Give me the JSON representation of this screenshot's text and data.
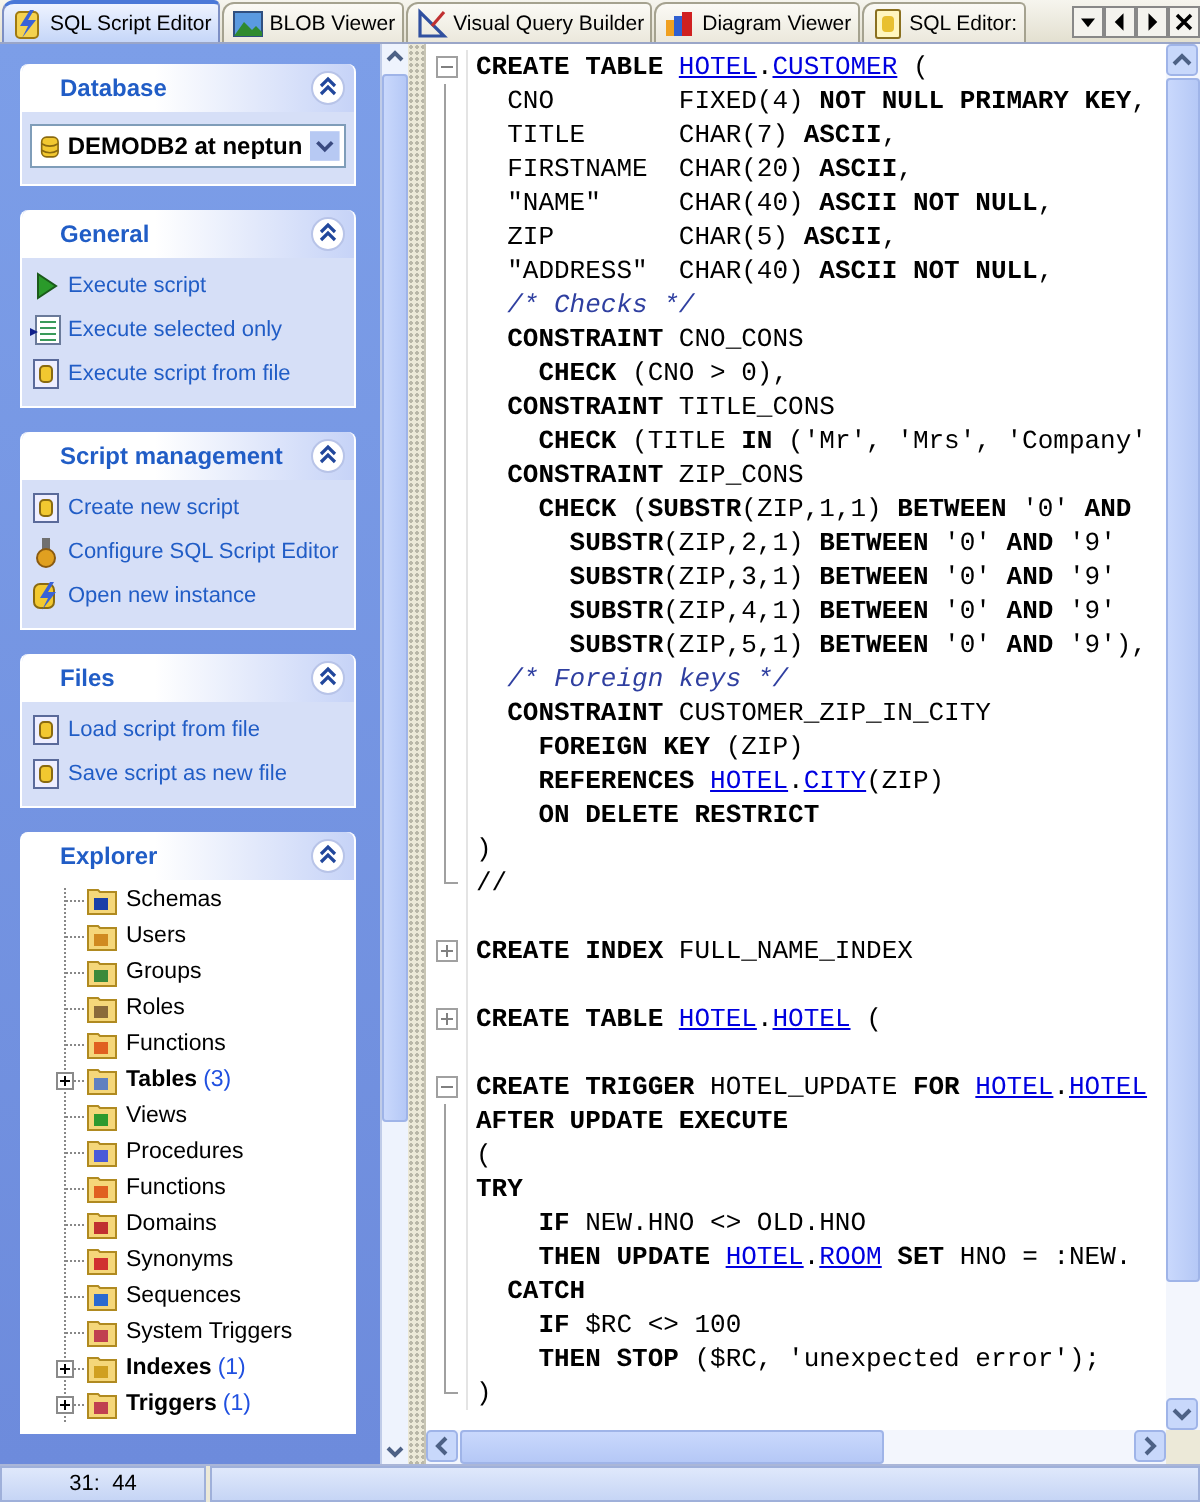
{
  "tabs": [
    {
      "label": "SQL Script Editor",
      "selected": true
    },
    {
      "label": "BLOB Viewer",
      "selected": false
    },
    {
      "label": "Visual Query Builder",
      "selected": false
    },
    {
      "label": "Diagram Viewer",
      "selected": false
    },
    {
      "label": "SQL Editor:",
      "selected": false
    }
  ],
  "sidebar": {
    "groups": [
      {
        "title": "Database",
        "expanded": true,
        "database": "DEMODB2 at neptun"
      },
      {
        "title": "General",
        "expanded": true,
        "items": [
          "Execute script",
          "Execute selected only",
          "Execute script from file"
        ]
      },
      {
        "title": "Script management",
        "expanded": true,
        "items": [
          "Create new script",
          "Configure SQL Script Editor",
          "Open new instance"
        ]
      },
      {
        "title": "Files",
        "expanded": true,
        "items": [
          "Load script from file",
          "Save script as new file"
        ]
      }
    ],
    "explorer": {
      "title": "Explorer",
      "expanded": true,
      "items": [
        {
          "label": "Schemas"
        },
        {
          "label": "Users"
        },
        {
          "label": "Groups"
        },
        {
          "label": "Roles"
        },
        {
          "label": "Functions"
        },
        {
          "label": "Tables",
          "count": "(3)",
          "expanded": false
        },
        {
          "label": "Views"
        },
        {
          "label": "Procedures"
        },
        {
          "label": "Functions"
        },
        {
          "label": "Domains"
        },
        {
          "label": "Synonyms"
        },
        {
          "label": "Sequences"
        },
        {
          "label": "System Triggers"
        },
        {
          "label": "Indexes",
          "count": "(1)",
          "expanded": false
        },
        {
          "label": "Triggers",
          "count": "(1)",
          "expanded": false
        }
      ]
    }
  },
  "editor": {
    "lines": [
      {
        "folded": false,
        "segments": [
          {
            "kind": "kw",
            "text": "CREATE TABLE "
          },
          {
            "kind": "link",
            "text": "HOTEL"
          },
          {
            "kind": "id",
            "text": "."
          },
          {
            "kind": "link",
            "text": "CUSTOMER"
          },
          {
            "kind": "id",
            "text": " ("
          }
        ]
      },
      {
        "segments": [
          {
            "kind": "id",
            "text": "  CNO        FIXED(4) "
          },
          {
            "kind": "kw",
            "text": "NOT NULL PRIMARY KEY"
          },
          {
            "kind": "id",
            "text": ","
          }
        ]
      },
      {
        "segments": [
          {
            "kind": "id",
            "text": "  TITLE      CHAR(7) "
          },
          {
            "kind": "kw",
            "text": "ASCII"
          },
          {
            "kind": "id",
            "text": ","
          }
        ]
      },
      {
        "segments": [
          {
            "kind": "id",
            "text": "  FIRSTNAME  CHAR(20) "
          },
          {
            "kind": "kw",
            "text": "ASCII"
          },
          {
            "kind": "id",
            "text": ","
          }
        ]
      },
      {
        "segments": [
          {
            "kind": "id",
            "text": "  \"NAME\"     CHAR(40) "
          },
          {
            "kind": "kw",
            "text": "ASCII NOT NULL"
          },
          {
            "kind": "id",
            "text": ","
          }
        ]
      },
      {
        "segments": [
          {
            "kind": "id",
            "text": "  ZIP        CHAR(5) "
          },
          {
            "kind": "kw",
            "text": "ASCII"
          },
          {
            "kind": "id",
            "text": ","
          }
        ]
      },
      {
        "segments": [
          {
            "kind": "id",
            "text": "  \"ADDRESS\"  CHAR(40) "
          },
          {
            "kind": "kw",
            "text": "ASCII NOT NULL"
          },
          {
            "kind": "id",
            "text": ","
          }
        ]
      },
      {
        "segments": [
          {
            "kind": "cm",
            "text": "  /* Checks */"
          }
        ]
      },
      {
        "segments": [
          {
            "kind": "kw",
            "text": "  CONSTRAINT "
          },
          {
            "kind": "id",
            "text": "CNO_CONS"
          }
        ]
      },
      {
        "segments": [
          {
            "kind": "kw",
            "text": "    CHECK "
          },
          {
            "kind": "id",
            "text": "(CNO > 0),"
          }
        ]
      },
      {
        "segments": [
          {
            "kind": "kw",
            "text": "  CONSTRAINT "
          },
          {
            "kind": "id",
            "text": "TITLE_CONS"
          }
        ]
      },
      {
        "segments": [
          {
            "kind": "kw",
            "text": "    CHECK "
          },
          {
            "kind": "id",
            "text": "(TITLE "
          },
          {
            "kind": "kw",
            "text": "IN"
          },
          {
            "kind": "id",
            "text": " ('Mr', 'Mrs', 'Company'"
          }
        ]
      },
      {
        "segments": [
          {
            "kind": "kw",
            "text": "  CONSTRAINT "
          },
          {
            "kind": "id",
            "text": "ZIP_CONS"
          }
        ]
      },
      {
        "segments": [
          {
            "kind": "kw",
            "text": "    CHECK "
          },
          {
            "kind": "id",
            "text": "("
          },
          {
            "kind": "kw",
            "text": "SUBSTR"
          },
          {
            "kind": "id",
            "text": "(ZIP,1,1) "
          },
          {
            "kind": "kw",
            "text": "BETWEEN"
          },
          {
            "kind": "id",
            "text": " '0' "
          },
          {
            "kind": "kw",
            "text": "AND"
          }
        ]
      },
      {
        "segments": [
          {
            "kind": "kw",
            "text": "      SUBSTR"
          },
          {
            "kind": "id",
            "text": "(ZIP,2,1) "
          },
          {
            "kind": "kw",
            "text": "BETWEEN"
          },
          {
            "kind": "id",
            "text": " '0' "
          },
          {
            "kind": "kw",
            "text": "AND"
          },
          {
            "kind": "id",
            "text": " '9'"
          }
        ]
      },
      {
        "segments": [
          {
            "kind": "kw",
            "text": "      SUBSTR"
          },
          {
            "kind": "id",
            "text": "(ZIP,3,1) "
          },
          {
            "kind": "kw",
            "text": "BETWEEN"
          },
          {
            "kind": "id",
            "text": " '0' "
          },
          {
            "kind": "kw",
            "text": "AND"
          },
          {
            "kind": "id",
            "text": " '9'"
          }
        ]
      },
      {
        "segments": [
          {
            "kind": "kw",
            "text": "      SUBSTR"
          },
          {
            "kind": "id",
            "text": "(ZIP,4,1) "
          },
          {
            "kind": "kw",
            "text": "BETWEEN"
          },
          {
            "kind": "id",
            "text": " '0' "
          },
          {
            "kind": "kw",
            "text": "AND"
          },
          {
            "kind": "id",
            "text": " '9'"
          }
        ]
      },
      {
        "segments": [
          {
            "kind": "kw",
            "text": "      SUBSTR"
          },
          {
            "kind": "id",
            "text": "(ZIP,5,1) "
          },
          {
            "kind": "kw",
            "text": "BETWEEN"
          },
          {
            "kind": "id",
            "text": " '0' "
          },
          {
            "kind": "kw",
            "text": "AND"
          },
          {
            "kind": "id",
            "text": " '9'),"
          }
        ]
      },
      {
        "segments": [
          {
            "kind": "cm",
            "text": "  /* Foreign keys */"
          }
        ]
      },
      {
        "segments": [
          {
            "kind": "kw",
            "text": "  CONSTRAINT "
          },
          {
            "kind": "id",
            "text": "CUSTOMER_ZIP_IN_CITY"
          }
        ]
      },
      {
        "segments": [
          {
            "kind": "kw",
            "text": "    FOREIGN KEY "
          },
          {
            "kind": "id",
            "text": "(ZIP)"
          }
        ]
      },
      {
        "segments": [
          {
            "kind": "kw",
            "text": "    REFERENCES "
          },
          {
            "kind": "link",
            "text": "HOTEL"
          },
          {
            "kind": "id",
            "text": "."
          },
          {
            "kind": "link",
            "text": "CITY"
          },
          {
            "kind": "id",
            "text": "(ZIP)"
          }
        ]
      },
      {
        "segments": [
          {
            "kind": "kw",
            "text": "    ON DELETE RESTRICT"
          }
        ]
      },
      {
        "segments": [
          {
            "kind": "id",
            "text": ")"
          }
        ]
      },
      {
        "segments": [
          {
            "kind": "id",
            "text": "//"
          }
        ]
      },
      {
        "gap_before": true,
        "folded": true,
        "segments": [
          {
            "kind": "kw",
            "text": "CREATE INDEX "
          },
          {
            "kind": "id",
            "text": "FULL_NAME_INDEX"
          }
        ]
      },
      {
        "gap_before": true,
        "folded": true,
        "segments": [
          {
            "kind": "kw",
            "text": "CREATE TABLE "
          },
          {
            "kind": "link",
            "text": "HOTEL"
          },
          {
            "kind": "id",
            "text": "."
          },
          {
            "kind": "link",
            "text": "HOTEL"
          },
          {
            "kind": "id",
            "text": " ("
          }
        ]
      },
      {
        "gap_before": true,
        "folded": false,
        "segments": [
          {
            "kind": "kw",
            "text": "CREATE TRIGGER "
          },
          {
            "kind": "id",
            "text": "HOTEL_UPDATE "
          },
          {
            "kind": "kw",
            "text": "FOR "
          },
          {
            "kind": "link",
            "text": "HOTEL"
          },
          {
            "kind": "id",
            "text": "."
          },
          {
            "kind": "link",
            "text": "HOTEL"
          }
        ]
      },
      {
        "segments": [
          {
            "kind": "kw",
            "text": "AFTER UPDATE EXECUTE"
          }
        ]
      },
      {
        "segments": [
          {
            "kind": "id",
            "text": "("
          }
        ]
      },
      {
        "segments": [
          {
            "kind": "kw",
            "text": "TRY"
          }
        ]
      },
      {
        "segments": [
          {
            "kind": "kw",
            "text": "    IF "
          },
          {
            "kind": "id",
            "text": "NEW.HNO <> OLD.HNO"
          }
        ]
      },
      {
        "segments": [
          {
            "kind": "kw",
            "text": "    THEN UPDATE "
          },
          {
            "kind": "link",
            "text": "HOTEL"
          },
          {
            "kind": "id",
            "text": "."
          },
          {
            "kind": "link",
            "text": "ROOM"
          },
          {
            "kind": "kw",
            "text": " SET "
          },
          {
            "kind": "id",
            "text": "HNO = :NEW."
          }
        ]
      },
      {
        "segments": [
          {
            "kind": "kw",
            "text": "  CATCH"
          }
        ]
      },
      {
        "segments": [
          {
            "kind": "kw",
            "text": "    IF "
          },
          {
            "kind": "id",
            "text": "$RC <> 100"
          }
        ]
      },
      {
        "segments": [
          {
            "kind": "kw",
            "text": "    THEN STOP "
          },
          {
            "kind": "id",
            "text": "($RC, 'unexpected error');"
          }
        ]
      },
      {
        "segments": [
          {
            "kind": "id",
            "text": ")"
          }
        ]
      }
    ]
  },
  "status_bar": {
    "position": "31:  44"
  }
}
